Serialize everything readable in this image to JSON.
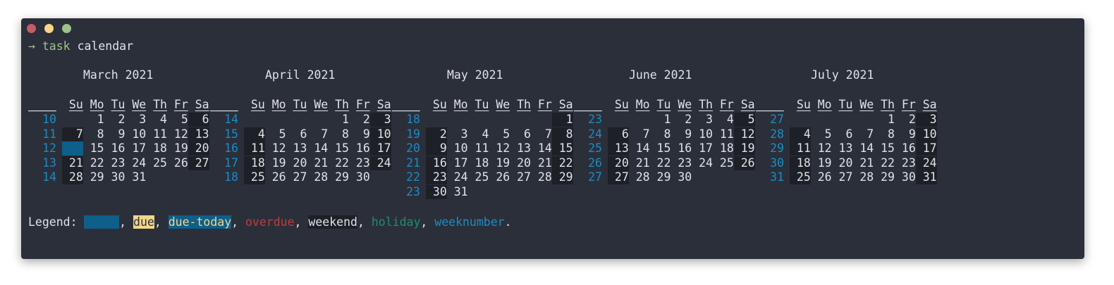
{
  "terminal": {
    "prompt_arrow": "→",
    "command_name": "task",
    "command_args": "calendar"
  },
  "day_headers": [
    "Su",
    "Mo",
    "Tu",
    "We",
    "Th",
    "Fr",
    "Sa"
  ],
  "week_header": "____",
  "months": [
    {
      "title": "March 2021",
      "weeks": [
        {
          "num": "10",
          "days": [
            "",
            "1",
            "2",
            "3",
            "4",
            "5",
            "6"
          ]
        },
        {
          "num": "11",
          "days": [
            "7",
            "8",
            "9",
            "10",
            "11",
            "12",
            "13"
          ]
        },
        {
          "num": "12",
          "days": [
            "14",
            "15",
            "16",
            "17",
            "18",
            "19",
            "20"
          ]
        },
        {
          "num": "13",
          "days": [
            "21",
            "22",
            "23",
            "24",
            "25",
            "26",
            "27"
          ]
        },
        {
          "num": "14",
          "days": [
            "28",
            "29",
            "30",
            "31",
            "",
            "",
            ""
          ]
        }
      ],
      "today": {
        "week": 2,
        "day": 0
      }
    },
    {
      "title": "April 2021",
      "weeks": [
        {
          "num": "14",
          "days": [
            "",
            "",
            "",
            "",
            "1",
            "2",
            "3"
          ]
        },
        {
          "num": "15",
          "days": [
            "4",
            "5",
            "6",
            "7",
            "8",
            "9",
            "10"
          ]
        },
        {
          "num": "16",
          "days": [
            "11",
            "12",
            "13",
            "14",
            "15",
            "16",
            "17"
          ]
        },
        {
          "num": "17",
          "days": [
            "18",
            "19",
            "20",
            "21",
            "22",
            "23",
            "24"
          ]
        },
        {
          "num": "18",
          "days": [
            "25",
            "26",
            "27",
            "28",
            "29",
            "30",
            ""
          ]
        }
      ]
    },
    {
      "title": "May 2021",
      "weeks": [
        {
          "num": "18",
          "days": [
            "",
            "",
            "",
            "",
            "",
            "",
            "1"
          ]
        },
        {
          "num": "19",
          "days": [
            "2",
            "3",
            "4",
            "5",
            "6",
            "7",
            "8"
          ]
        },
        {
          "num": "20",
          "days": [
            "9",
            "10",
            "11",
            "12",
            "13",
            "14",
            "15"
          ]
        },
        {
          "num": "21",
          "days": [
            "16",
            "17",
            "18",
            "19",
            "20",
            "21",
            "22"
          ]
        },
        {
          "num": "22",
          "days": [
            "23",
            "24",
            "25",
            "26",
            "27",
            "28",
            "29"
          ]
        },
        {
          "num": "23",
          "days": [
            "30",
            "31",
            "",
            "",
            "",
            "",
            ""
          ]
        }
      ]
    },
    {
      "title": "June 2021",
      "weeks": [
        {
          "num": "23",
          "days": [
            "",
            "",
            "1",
            "2",
            "3",
            "4",
            "5"
          ]
        },
        {
          "num": "24",
          "days": [
            "6",
            "7",
            "8",
            "9",
            "10",
            "11",
            "12"
          ]
        },
        {
          "num": "25",
          "days": [
            "13",
            "14",
            "15",
            "16",
            "17",
            "18",
            "19"
          ]
        },
        {
          "num": "26",
          "days": [
            "20",
            "21",
            "22",
            "23",
            "24",
            "25",
            "26"
          ]
        },
        {
          "num": "27",
          "days": [
            "27",
            "28",
            "29",
            "30",
            "",
            "",
            ""
          ]
        }
      ]
    },
    {
      "title": "July 2021",
      "weeks": [
        {
          "num": "27",
          "days": [
            "",
            "",
            "",
            "",
            "1",
            "2",
            "3"
          ]
        },
        {
          "num": "28",
          "days": [
            "4",
            "5",
            "6",
            "7",
            "8",
            "9",
            "10"
          ]
        },
        {
          "num": "29",
          "days": [
            "11",
            "12",
            "13",
            "14",
            "15",
            "16",
            "17"
          ]
        },
        {
          "num": "30",
          "days": [
            "18",
            "19",
            "20",
            "21",
            "22",
            "23",
            "24"
          ]
        },
        {
          "num": "31",
          "days": [
            "25",
            "26",
            "27",
            "28",
            "29",
            "30",
            "31"
          ]
        }
      ]
    }
  ],
  "legend": {
    "label": "Legend: ",
    "items": [
      {
        "key": "today",
        "text": "today"
      },
      {
        "key": "due",
        "text": "due"
      },
      {
        "key": "duetoday",
        "text": "due-today"
      },
      {
        "key": "overdue",
        "text": "overdue"
      },
      {
        "key": "weekend",
        "text": "weekend"
      },
      {
        "key": "holiday",
        "text": "holiday"
      },
      {
        "key": "week",
        "text": "weeknumber"
      }
    ],
    "separator": ", ",
    "terminator": "."
  },
  "colors": {
    "background": "#2b2f3a",
    "text": "#dfe2e8",
    "weeknumber": "#1b8cc2",
    "weekend_bg": "#1e2027",
    "today_bg": "#0e5f8a",
    "due_bg": "#f4d58a",
    "overdue": "#c43b3b",
    "holiday": "#1f8f6a",
    "prompt": "#9ec28a"
  }
}
